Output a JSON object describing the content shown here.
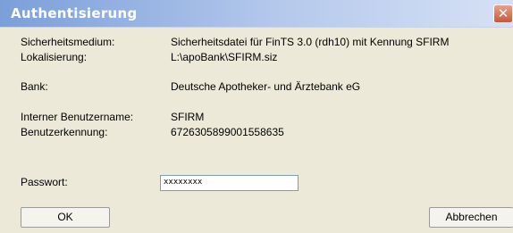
{
  "window": {
    "title": "Authentisierung",
    "close_label": "✕"
  },
  "fields": {
    "medium_label": "Sicherheitsmedium:",
    "medium_value": "Sicherheitsdatei für FinTS 3.0 (rdh10) mit Kennung SFIRM",
    "location_label": "Lokalisierung:",
    "location_value": "L:\\apoBank\\SFIRM.siz",
    "bank_label": "Bank:",
    "bank_value": "Deutsche Apotheker- und Ärztebank eG",
    "user_label": "Interner Benutzername:",
    "user_value": "SFIRM",
    "userid_label": "Benutzerkennung:",
    "userid_value": "6726305899001558635",
    "password_label": "Passwort:",
    "password_value": "xxxxxxxx"
  },
  "buttons": {
    "ok": "OK",
    "cancel": "Abbrechen"
  }
}
